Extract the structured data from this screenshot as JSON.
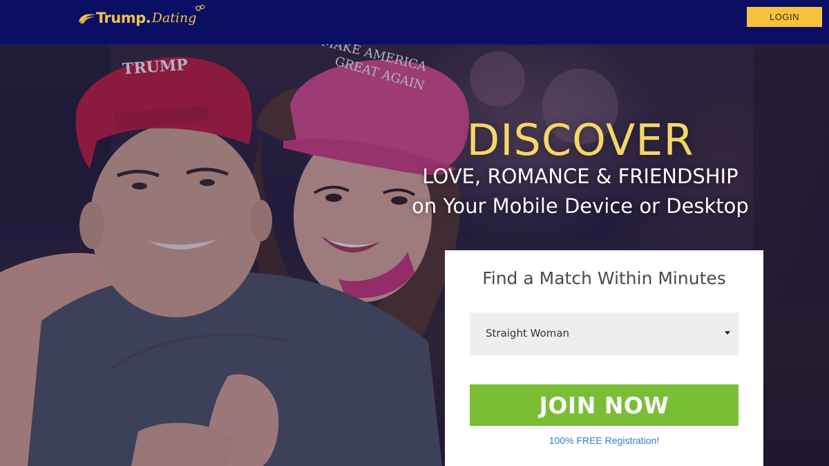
{
  "header": {
    "logo": {
      "main": "Trump",
      "dot": ".",
      "sub": "Dating"
    },
    "login_label": "LOGIN"
  },
  "hero": {
    "image_description": "smiling couple wearing red TRUMP cap and pink MAKE AMERICA GREAT AGAIN cap",
    "cap_left_text": "TRUMP",
    "cap_right_line1": "MAKE AMERICA",
    "cap_right_line2": "GREAT AGAIN",
    "headline": "DISCOVER",
    "subline1": "LOVE, ROMANCE & FRIENDSHIP",
    "subline2": "on Your Mobile Device or Desktop"
  },
  "form": {
    "title": "Find a Match Within Minutes",
    "select_value": "Straight Woman",
    "join_label": "JOIN NOW",
    "free_text": "100% FREE Registration!"
  },
  "colors": {
    "header_bg": "#0b0f63",
    "login_bg": "#f7c23c",
    "headline": "#f5d766",
    "join_bg": "#79be34",
    "link": "#2f7cc9"
  }
}
